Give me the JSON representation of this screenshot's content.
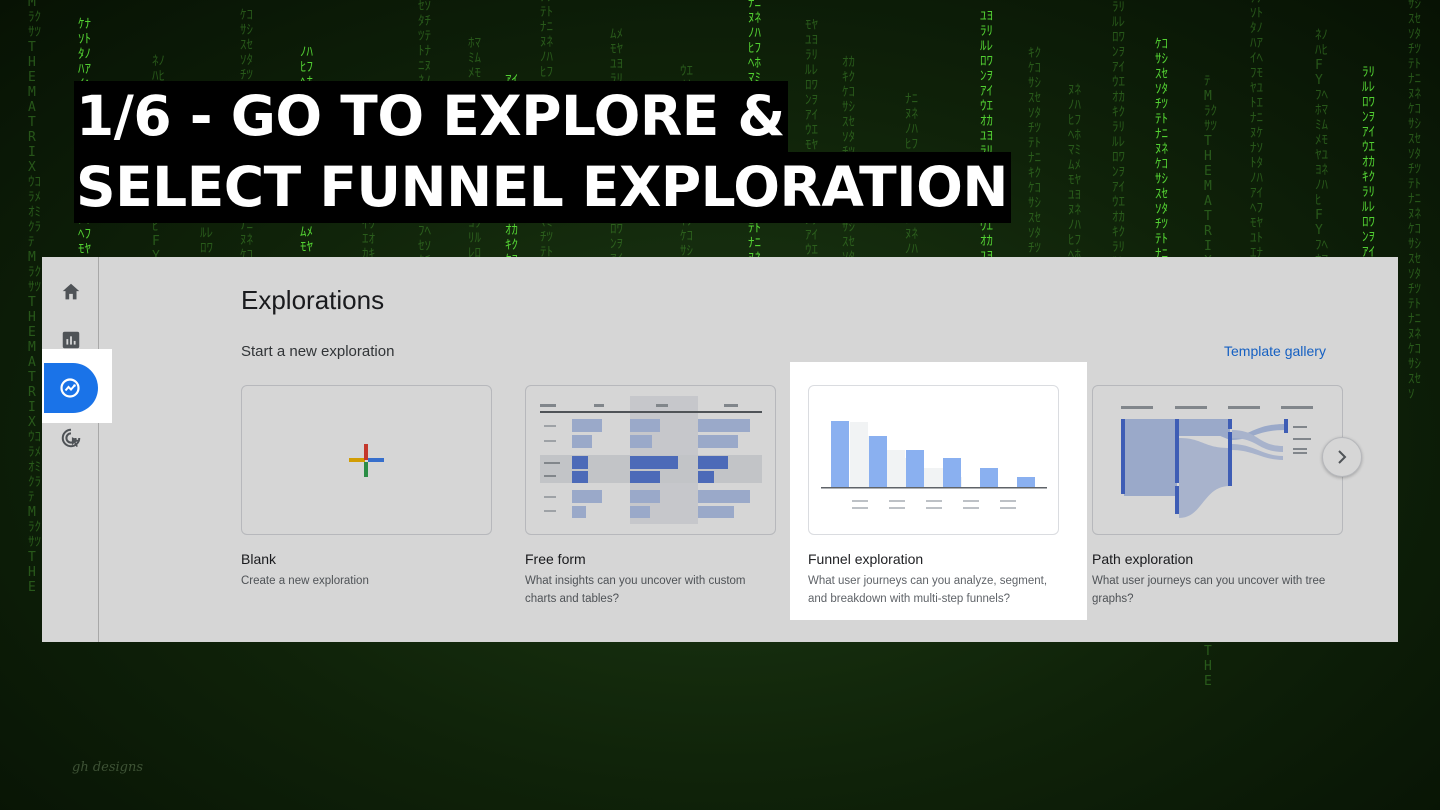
{
  "headline": {
    "line1": "1/6 - GO TO EXPLORE &",
    "line2": "SELECT FUNNEL EXPLORATION"
  },
  "watermark": "gh designs",
  "background_rain": [
    "ﾃMﾗｸｻﾂTHEMATRIXｳｺﾗﾒｵﾐｸﾗ",
    "ｹﾅｿﾄﾀﾉﾊｱｲﾍﾌﾓﾔﾕﾄｴﾅﾆﾇ",
    "ﾈﾉﾊﾋFYﾌﾍﾎﾏﾐﾑﾒﾓﾔﾕﾖ",
    "ﾗﾘﾙﾚﾛﾜﾝｦｱｲｳｴｵｶｷｸ",
    "ｹｺｻｼｽｾｿﾀﾁﾂﾃﾄﾅﾆﾇﾈ",
    "ﾉﾊﾋﾌﾍﾎﾏﾐﾑﾒﾓﾔﾕﾖﾗﾘ",
    "ﾝｦｱｲｳｴｵｶｷｸｹｺｻｼｽ",
    "ｾｿﾀﾁﾂﾃﾄﾅﾆﾇﾈﾉﾊﾋﾌﾍ",
    "ﾎﾏﾐﾑﾒﾓﾔﾕﾖﾗﾘﾙﾚﾛﾜﾝ",
    "ｱｲｳｴｵｶｷｸｹｺｻｼｽｾｿﾀ",
    "ﾁﾂﾃﾄﾅﾆﾇﾈﾉﾊﾋﾌﾍﾎﾏﾐ",
    "ﾑﾒﾓﾔﾕﾖﾗﾘﾙﾚﾛﾜﾝｦｱｲ",
    "ｳｴｵｶｷｸｹｺｻｼｽｾｿﾀﾁﾂ",
    "ﾃﾄﾅﾆﾇﾈﾉﾊﾋﾌﾍﾎﾏﾐﾑﾒ",
    "ﾓﾔﾕﾖﾗﾘﾙﾚﾛﾜﾝｦｱｲｳｴ",
    "ｵｶｷｸｹｺｻｼｽｾｿﾀﾁﾂﾃﾄ",
    "ﾅﾆﾇﾈﾉﾊﾋﾌﾍﾎﾏﾐﾑﾒﾓﾔ",
    "ﾕﾖﾗﾘﾙﾚﾛﾜﾝｦｱｲｳｴｵｶ",
    "ｷｸｹｺｻｼｽｾｿﾀﾁﾂﾃﾄﾅﾆ",
    "ﾇﾈﾉﾊﾋﾌﾍﾎﾏﾐﾑﾒﾓﾔﾕﾖ",
    "ﾗﾘﾙﾚﾛﾜﾝｦｱｲｳｴｵｶｷｸ",
    "ｹｺｻｼｽｾｿﾀﾁﾂﾃﾄﾅﾆﾇﾈ"
  ],
  "colors": {
    "accent_blue": "#1a73e8",
    "bar_blue": "#8ab0f0",
    "sankey_blue": "#4a6fd8",
    "rail_active": "#1a73e8",
    "google_red": "#ea4335",
    "google_blue": "#4285f4",
    "google_yellow": "#fbbc04",
    "google_green": "#34a853"
  },
  "nav": {
    "items": [
      {
        "icon": "home-icon"
      },
      {
        "icon": "reports-icon"
      },
      {
        "icon": "explore-icon",
        "active": true
      },
      {
        "icon": "advertising-icon"
      }
    ]
  },
  "explorations": {
    "title": "Explorations",
    "subtitle": "Start a new exploration",
    "gallery_link": "Template gallery",
    "next_icon": "chevron-right-icon",
    "cards": [
      {
        "title": "Blank",
        "description": "Create a new exploration",
        "thumbnail": "plus-icon"
      },
      {
        "title": "Free form",
        "description": "What insights can you uncover with custom charts and tables?",
        "thumbnail": "table-thumbnail"
      },
      {
        "title": "Funnel exploration",
        "description": "What user journeys can you analyze, segment, and breakdown with multi-step funnels?",
        "thumbnail": "funnel-chart-thumbnail",
        "highlighted": true
      },
      {
        "title": "Path exploration",
        "description": "What user journeys can you uncover with tree graphs?",
        "thumbnail": "sankey-thumbnail"
      }
    ]
  }
}
